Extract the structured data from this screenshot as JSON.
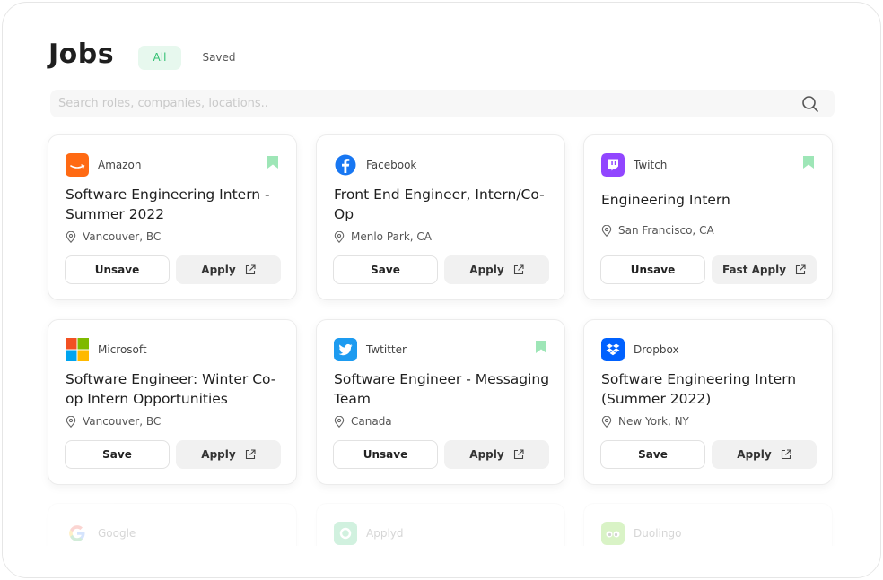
{
  "header": {
    "title": "Jobs",
    "tabs": [
      {
        "label": "All"
      },
      {
        "label": "Saved"
      }
    ]
  },
  "search": {
    "placeholder": "Search roles, companies, locations.."
  },
  "colors": {
    "accent_green": "#34c173",
    "bookmark_green": "#9ee6b7"
  },
  "jobs": [
    {
      "company": "Amazon",
      "logo_icon": "amazon-logo-icon",
      "title": "Software Engineering Intern - Summer 2022",
      "location": "Vancouver, BC",
      "save_label": "Unsave",
      "apply_label": "Apply",
      "bookmarked": true
    },
    {
      "company": "Facebook",
      "logo_icon": "facebook-logo-icon",
      "title": "Front End Engineer, Intern/Co-Op",
      "location": "Menlo Park, CA",
      "save_label": "Save",
      "apply_label": "Apply",
      "bookmarked": false
    },
    {
      "company": "Twitch",
      "logo_icon": "twitch-logo-icon",
      "title": "Engineering Intern",
      "location": "San Francisco, CA",
      "save_label": "Unsave",
      "apply_label": "Fast Apply",
      "bookmarked": true
    },
    {
      "company": "Microsoft",
      "logo_icon": "microsoft-logo-icon",
      "title": "Software Engineer: Winter Co-op Intern Opportunities",
      "location": "Vancouver, BC",
      "save_label": "Save",
      "apply_label": "Apply",
      "bookmarked": false
    },
    {
      "company": "Twtitter",
      "logo_icon": "twitter-logo-icon",
      "title": "Software Engineer - Messaging Team",
      "location": "Canada",
      "save_label": "Unsave",
      "apply_label": "Apply",
      "bookmarked": true
    },
    {
      "company": "Dropbox",
      "logo_icon": "dropbox-logo-icon",
      "title": "Software Engineering Intern (Summer 2022)",
      "location": "New York, NY",
      "save_label": "Save",
      "apply_label": "Apply",
      "bookmarked": false
    },
    {
      "company": "Google",
      "logo_icon": "google-logo-icon"
    },
    {
      "company": "Applyd",
      "logo_icon": "applyd-logo-icon"
    },
    {
      "company": "Duolingo",
      "logo_icon": "duolingo-logo-icon"
    }
  ]
}
